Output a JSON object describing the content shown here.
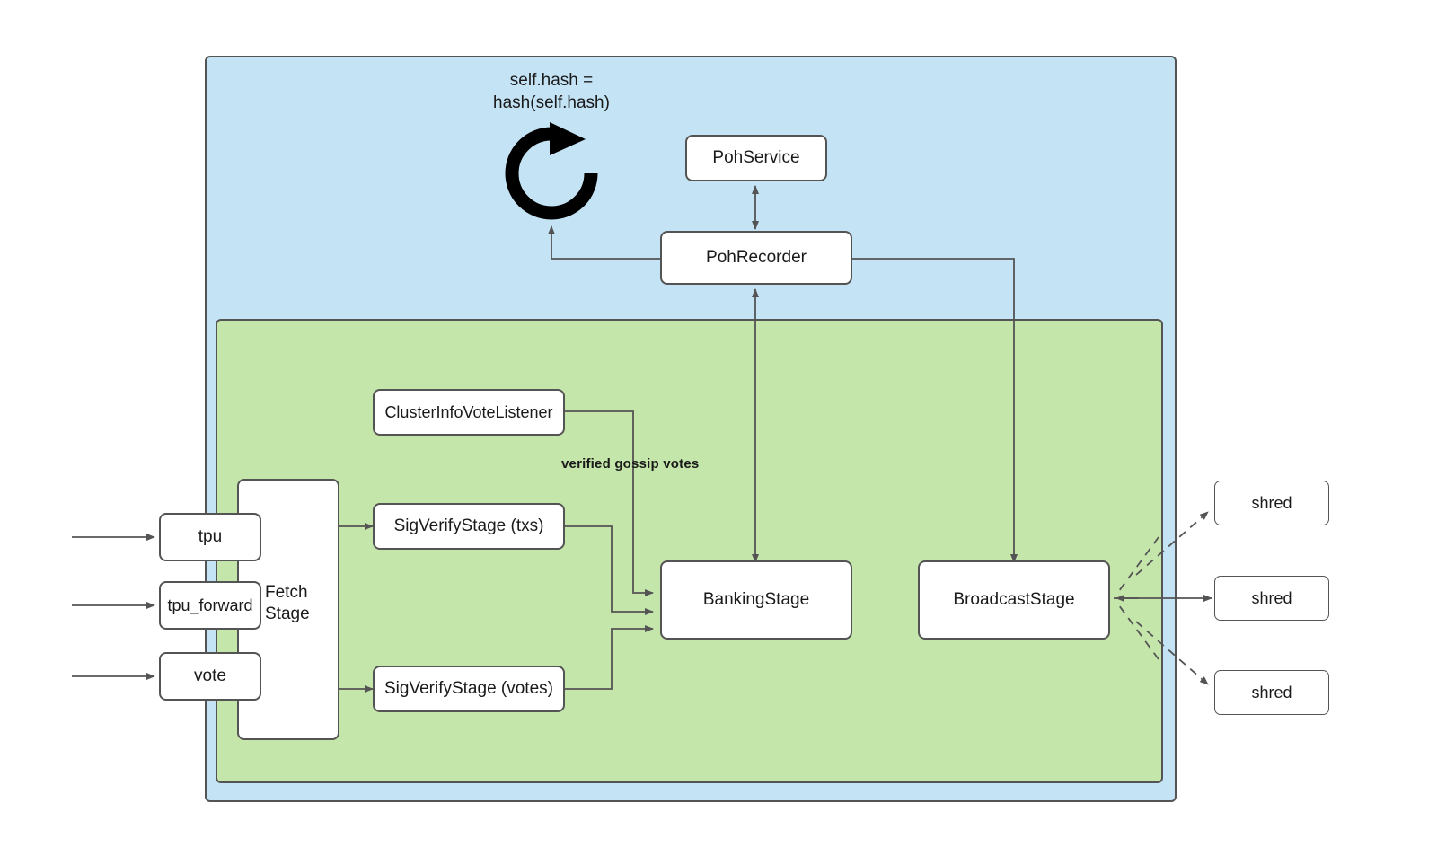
{
  "diagram": {
    "title": "Solana TPU / PoH pipeline",
    "colors": {
      "outer_container_fill": "#c4e3f5",
      "inner_container_fill": "#c5e6ab",
      "node_fill": "#ffffff",
      "stroke": "#545454",
      "text": "#1a1a1a"
    }
  },
  "containers": [
    {
      "name": "poh-container",
      "fill": "#c4e3f5"
    },
    {
      "name": "tpu-container",
      "fill": "#c5e6ab"
    }
  ],
  "annotations": {
    "hash_loop": "self.hash =\nhash(self.hash)",
    "hash_loop_line1": "self.hash =",
    "hash_loop_line2": "hash(self.hash)",
    "loop_icon_name": "refresh-loop-icon",
    "verified_gossip_votes": "verified gossip votes"
  },
  "nodes": {
    "poh_service": "PohService",
    "poh_recorder": "PohRecorder",
    "cluster_info_vote_listener": "ClusterInfoVoteListener",
    "sigverify_txs": "SigVerifyStage (txs)",
    "sigverify_votes": "SigVerifyStage (votes)",
    "banking_stage": "BankingStage",
    "broadcast_stage": "BroadcastStage",
    "fetch_stage_line1": "Fetch",
    "fetch_stage_line2": "Stage",
    "tpu": "tpu",
    "tpu_forward": "tpu_forward",
    "vote": "vote",
    "shred_1": "shred",
    "shred_2": "shred",
    "shred_3": "shred"
  },
  "edges": [
    {
      "name": "ingress-to-tpu",
      "from": "external",
      "to": "tpu",
      "style": "solid",
      "arrow": "end"
    },
    {
      "name": "ingress-to-tpu-forward",
      "from": "external",
      "to": "tpu_forward",
      "style": "solid",
      "arrow": "end"
    },
    {
      "name": "ingress-to-vote",
      "from": "external",
      "to": "vote",
      "style": "solid",
      "arrow": "end"
    },
    {
      "name": "fetch-to-sigverify-txs",
      "from": "fetch_stage",
      "to": "sigverify_txs",
      "style": "solid",
      "arrow": "end"
    },
    {
      "name": "fetch-to-sigverify-votes",
      "from": "fetch_stage",
      "to": "sigverify_votes",
      "style": "solid",
      "arrow": "end"
    },
    {
      "name": "cluster-info-vote-listener-to-banking-stage",
      "from": "cluster_info_vote_listener",
      "to": "banking_stage",
      "style": "solid",
      "arrow": "end",
      "label": "verified gossip votes"
    },
    {
      "name": "sigverify-txs-to-banking-stage",
      "from": "sigverify_txs",
      "to": "banking_stage",
      "style": "solid",
      "arrow": "end"
    },
    {
      "name": "sigverify-votes-to-banking-stage",
      "from": "sigverify_votes",
      "to": "banking_stage",
      "style": "solid",
      "arrow": "end"
    },
    {
      "name": "poh-service-poh-recorder",
      "from": "poh_service",
      "to": "poh_recorder",
      "style": "solid",
      "arrow": "both"
    },
    {
      "name": "poh-recorder-banking-stage",
      "from": "poh_recorder",
      "to": "banking_stage",
      "style": "solid",
      "arrow": "both"
    },
    {
      "name": "poh-recorder-to-hash-loop",
      "from": "poh_recorder",
      "to": "hash_loop",
      "style": "solid",
      "arrow": "end"
    },
    {
      "name": "poh-recorder-to-broadcast-stage",
      "from": "poh_recorder",
      "to": "broadcast_stage",
      "style": "solid",
      "arrow": "end"
    },
    {
      "name": "broadcast-stage-to-shred-1",
      "from": "broadcast_stage",
      "to": "shred_1",
      "style": "dashed",
      "arrow": "end"
    },
    {
      "name": "broadcast-stage-to-shred-2",
      "from": "broadcast_stage",
      "to": "shred_2",
      "style": "solid",
      "arrow": "end"
    },
    {
      "name": "broadcast-stage-to-shred-3",
      "from": "broadcast_stage",
      "to": "shred_3",
      "style": "dashed",
      "arrow": "end"
    }
  ]
}
